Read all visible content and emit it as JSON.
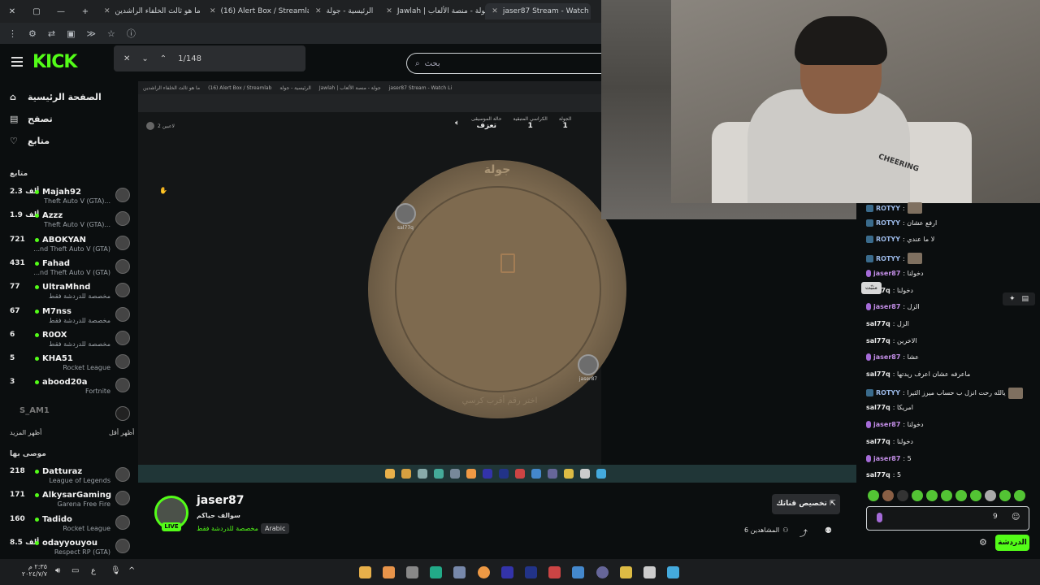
{
  "browser": {
    "tabs": [
      {
        "label": "ما هو ثالث الخلفاء الراشدين"
      },
      {
        "label": "(16) Alert Box / Streamlab"
      },
      {
        "label": "الرئيسية - جولة"
      },
      {
        "label": "Jawlah | جولة - منصة الألعاب"
      },
      {
        "label": "jaser87 Stream - Watch Li"
      }
    ],
    "find": {
      "count": "1/148"
    }
  },
  "header": {
    "logo": "KICK",
    "search_placeholder": "بحث"
  },
  "sidebar": {
    "nav": [
      {
        "label": "الصفحة الرئيسية",
        "icon": "home-icon"
      },
      {
        "label": "تصفح",
        "icon": "browse-icon"
      },
      {
        "label": "متابع",
        "icon": "heart-icon"
      }
    ],
    "following_header": "متابع",
    "following": [
      {
        "name": "Majah92",
        "count": "2.3 ألف",
        "game": "Theft Auto V (GTA)..."
      },
      {
        "name": "Azzz",
        "count": "1.9 ألف",
        "game": "Theft Auto V (GTA)..."
      },
      {
        "name": "ABOKYAN",
        "count": "721",
        "game": "...nd Theft Auto V (GTA)"
      },
      {
        "name": "Fahad",
        "count": "431",
        "game": "...nd Theft Auto V (GTA)"
      },
      {
        "name": "UltraMhnd",
        "count": "77",
        "game": "مخصصة للدردشة فقط"
      },
      {
        "name": "M7nss",
        "count": "67",
        "game": "مخصصة للدردشة فقط"
      },
      {
        "name": "R0OX",
        "count": "6",
        "game": "مخصصة للدردشة فقط"
      },
      {
        "name": "KHA51",
        "count": "5",
        "game": "Rocket League"
      },
      {
        "name": "abood20a",
        "count": "3",
        "game": "Fortnite"
      }
    ],
    "offline": "S_AM1",
    "show_more": "أظهر المزيد",
    "show_less": "أظهر أقل",
    "recommended_header": "موصى بها",
    "recommended": [
      {
        "name": "Datturaz",
        "count": "218",
        "game": "League of Legends"
      },
      {
        "name": "AlkysarGaming",
        "count": "171",
        "game": "Garena Free Fire"
      },
      {
        "name": "Tadido",
        "count": "160",
        "game": "Rocket League"
      },
      {
        "name": "odayyouyou",
        "count": "8.5 ألف",
        "game": "Respect RP (GTA)"
      }
    ]
  },
  "game": {
    "title": "جولة",
    "hint": "اختر رقم أقرب كرسي",
    "stats": [
      {
        "label": "الجولة",
        "value": "1"
      },
      {
        "label": "الكراسي المتبقية",
        "value": "1"
      },
      {
        "label": "حالة الموسيقى",
        "value": "تعزف"
      }
    ],
    "room": "2 لاعبين",
    "players": [
      {
        "name": "sal77q"
      },
      {
        "name": "jaser87"
      }
    ]
  },
  "channel": {
    "name": "jaser87",
    "subtitle": "سوالف حياكم",
    "category": "مخصصة للدردشة فقط",
    "language": "Arabic",
    "live": "LIVE",
    "customize": "تخصيص قناتك",
    "viewers": "6 المشاهدين"
  },
  "chat": {
    "messages": [
      {
        "user": "ROTYY",
        "text": ":",
        "kind": "badge",
        "img": true
      },
      {
        "user": "ROTYY",
        "text": ": ارفع عشان",
        "kind": "badge"
      },
      {
        "user": "ROTYY",
        "text": ": لا ما عندي",
        "kind": "badge"
      },
      {
        "user": "ROTYY",
        "text": ":",
        "kind": "badge",
        "img": true
      },
      {
        "user": "jaser87",
        "text": ": دخولنا",
        "kind": "mic"
      },
      {
        "user": "sal77q",
        "text": ": دخولنا",
        "kind": "none"
      },
      {
        "user": "jaser87",
        "text": ": الزل",
        "kind": "mic"
      },
      {
        "user": "sal77q",
        "text": ": الزل",
        "kind": "none"
      },
      {
        "user": "sal77q",
        "text": ": الاخرين",
        "kind": "none"
      },
      {
        "user": "jaser87",
        "text": ": عشا",
        "kind": "mic"
      },
      {
        "user": "sal77q",
        "text": ": ماعرفه عشان اعرف ريدتها",
        "kind": "none"
      },
      {
        "user": "ROTYY",
        "text": ": يالله رحت انزل ب حساب ميرز الثيرا",
        "kind": "badge",
        "img": true
      },
      {
        "user": "sal77q",
        "text": ": امريكا",
        "kind": "none"
      },
      {
        "user": "jaser87",
        "text": ": دخولنا",
        "kind": "mic"
      },
      {
        "user": "sal77q",
        "text": ": دخولنا",
        "kind": "none"
      },
      {
        "user": "jaser87",
        "text": ": 5",
        "kind": "mic"
      },
      {
        "user": "sal77q",
        "text": ": 5",
        "kind": "none"
      }
    ],
    "tooltip": "مثبّت",
    "input_value": "9",
    "send_label": "الدردشة"
  },
  "webcam": {
    "shirt_text": "CHEERING"
  },
  "taskbar": {
    "time": "٢:٣٥ م",
    "date": "٢٠٢٤/٧/٧"
  },
  "colors": {
    "accent": "#53fc18",
    "background": "#0b0e0f"
  }
}
